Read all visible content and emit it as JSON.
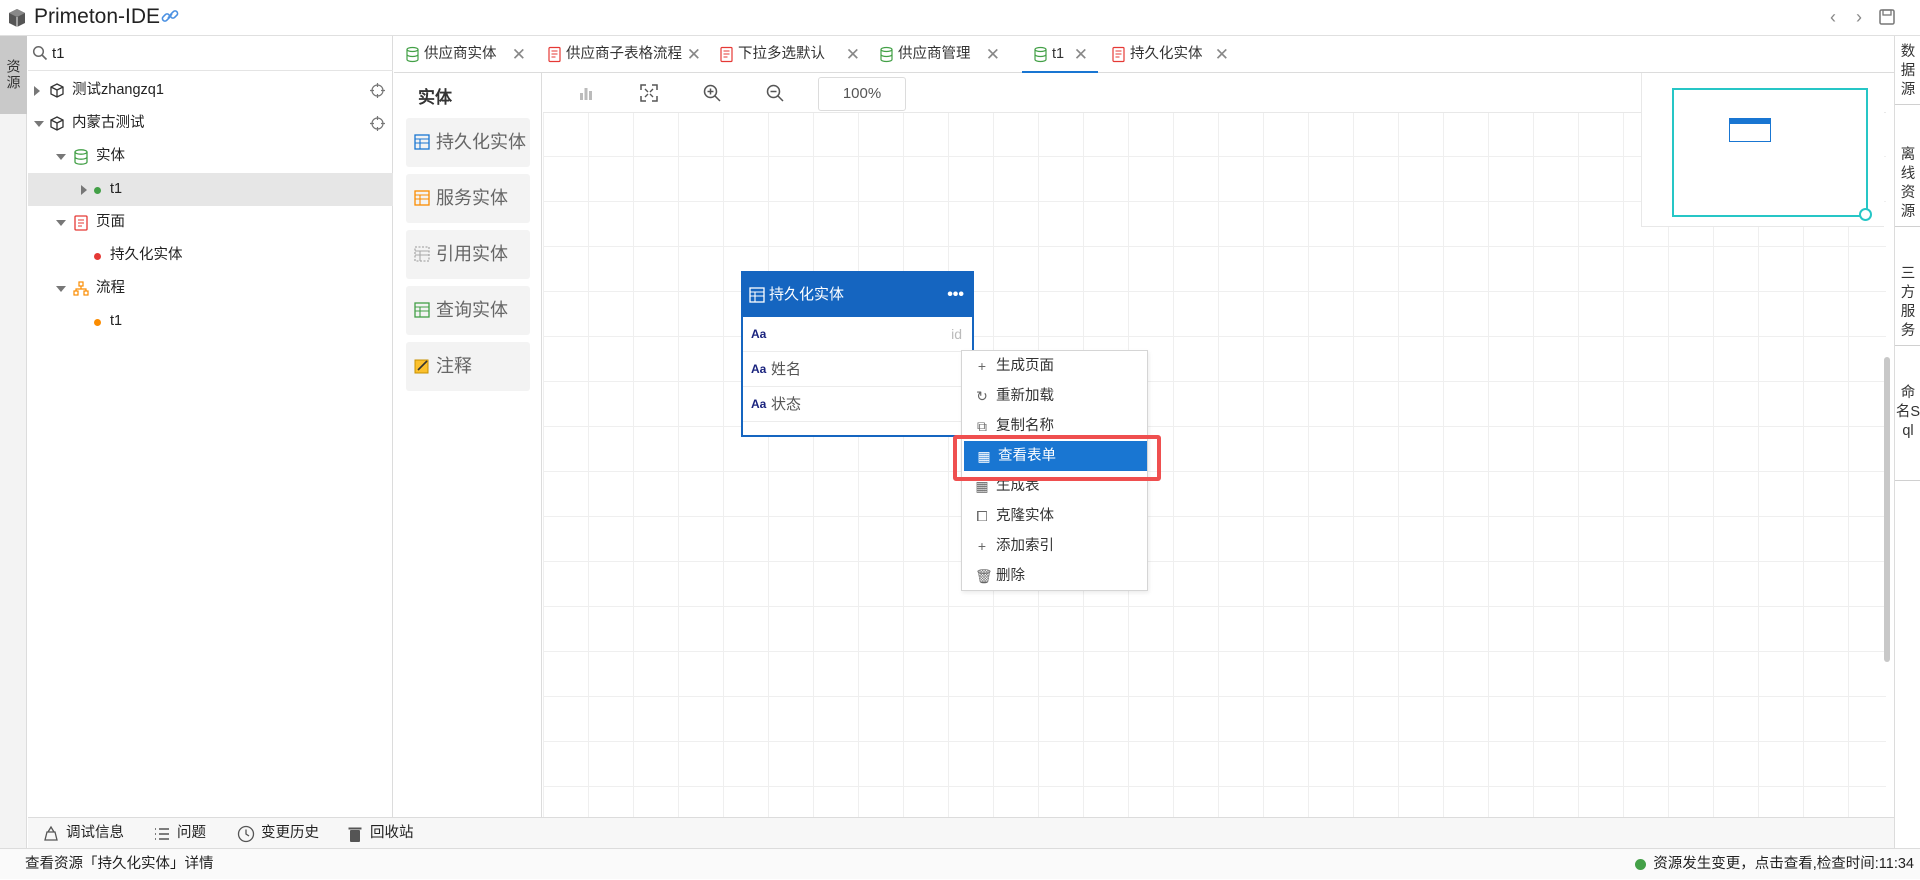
{
  "app": {
    "title": "Primeton-IDE"
  },
  "left_strip": {
    "tab_label": "资源"
  },
  "search": {
    "value": "t1"
  },
  "tree": {
    "items": [
      {
        "label": "测试zhangzq1"
      },
      {
        "label": "内蒙古测试"
      },
      {
        "label": "实体"
      },
      {
        "label": "t1"
      },
      {
        "label": "页面"
      },
      {
        "label": "持久化实体"
      },
      {
        "label": "流程"
      },
      {
        "label": "t1"
      }
    ]
  },
  "tabs": [
    {
      "label": "供应商实体",
      "icon": "database-icon"
    },
    {
      "label": "供应商子表格流程",
      "icon": "document-icon"
    },
    {
      "label": "下拉多选默认",
      "icon": "document-icon"
    },
    {
      "label": "供应商管理",
      "icon": "database-icon"
    },
    {
      "label": "t1",
      "icon": "database-icon"
    },
    {
      "label": "持久化实体",
      "icon": "document-icon"
    }
  ],
  "palette": {
    "title": "实体",
    "items": [
      {
        "label": "持久化实体"
      },
      {
        "label": "服务实体"
      },
      {
        "label": "引用实体"
      },
      {
        "label": "查询实体"
      },
      {
        "label": "注释"
      }
    ]
  },
  "canvas": {
    "zoom": "100%"
  },
  "entity_card": {
    "title": "持久化实体",
    "more": "•••",
    "fields": [
      {
        "type": "Aa",
        "name": "",
        "value": "id"
      },
      {
        "type": "Aa",
        "name": "姓名",
        "value": ""
      },
      {
        "type": "Aa",
        "name": "状态",
        "value": ""
      }
    ]
  },
  "context_menu": {
    "items": [
      {
        "label": "生成页面"
      },
      {
        "label": "重新加载"
      },
      {
        "label": "复制名称"
      },
      {
        "label": "查看表单"
      },
      {
        "label": "生成表"
      },
      {
        "label": "克隆实体"
      },
      {
        "label": "添加索引"
      },
      {
        "label": "删除"
      }
    ]
  },
  "right_strip": {
    "tabs": [
      {
        "label": "数据源"
      },
      {
        "label": "离线资源"
      },
      {
        "label": "三方服务"
      },
      {
        "label": "命名Sql"
      }
    ]
  },
  "bottom_bar": {
    "items": [
      {
        "label": "调试信息"
      },
      {
        "label": "问题"
      },
      {
        "label": "变更历史"
      },
      {
        "label": "回收站"
      }
    ]
  },
  "status": {
    "left": "查看资源「持久化实体」详情",
    "right": "资源发生变更，点击查看,检查时间:11:34"
  },
  "colors": {
    "accent": "#1565c0",
    "highlight_frame": "#ef4f4f",
    "minimap": "#26c6c6",
    "status_ok": "#43a047"
  }
}
